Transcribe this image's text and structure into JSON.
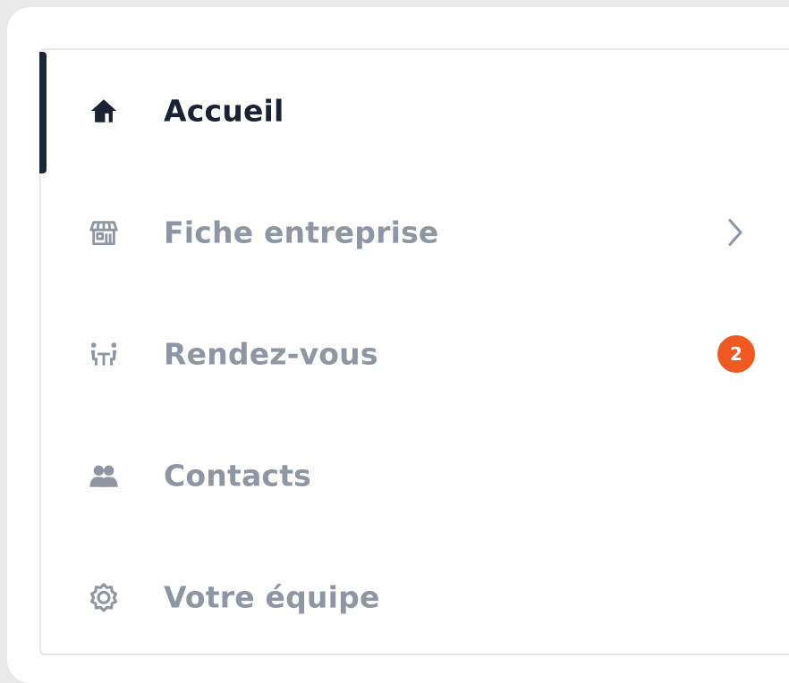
{
  "menu": {
    "items": [
      {
        "label": "Accueil",
        "icon": "home-icon",
        "active": true
      },
      {
        "label": "Fiche entreprise",
        "icon": "storefront-icon",
        "has_submenu": true
      },
      {
        "label": "Rendez-vous",
        "icon": "meeting-icon",
        "badge": "2"
      },
      {
        "label": "Contacts",
        "icon": "contacts-icon"
      },
      {
        "label": "Votre équipe",
        "icon": "gear-icon"
      }
    ]
  },
  "colors": {
    "active_text": "#1b2233",
    "inactive_text": "#8d96a2",
    "active_indicator": "#1d2433",
    "badge": "#f25822",
    "border": "#e5e7ea",
    "background": "#e9e9ea"
  }
}
